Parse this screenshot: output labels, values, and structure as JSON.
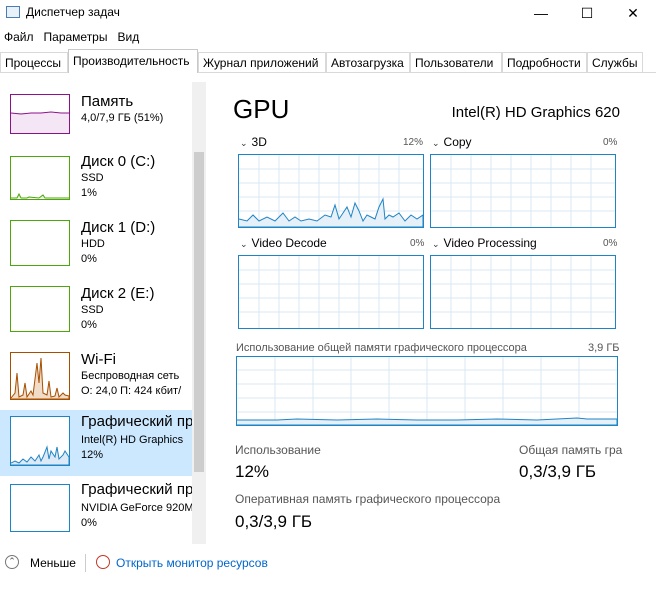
{
  "window": {
    "title": "Диспетчер задач",
    "minimize_glyph": "—",
    "maximize_glyph": "☐",
    "close_glyph": "✕"
  },
  "menu": [
    "Файл",
    "Параметры",
    "Вид"
  ],
  "tabs": [
    {
      "label": "Процессы",
      "active": false
    },
    {
      "label": "Производительность",
      "active": true
    },
    {
      "label": "Журнал приложений",
      "active": false
    },
    {
      "label": "Автозагрузка",
      "active": false
    },
    {
      "label": "Пользователи",
      "active": false
    },
    {
      "label": "Подробности",
      "active": false
    },
    {
      "label": "Службы",
      "active": false
    }
  ],
  "sidebar": {
    "items": [
      {
        "name": "Память",
        "line1": "4,0/7,9 ГБ (51%)",
        "line2": "",
        "color": "#8b128b",
        "selected": false
      },
      {
        "name": "Диск 0 (C:)",
        "line1": "SSD",
        "line2": "1%",
        "color": "#4da60c",
        "selected": false
      },
      {
        "name": "Диск 1 (D:)",
        "line1": "HDD",
        "line2": "0%",
        "color": "#4da60c",
        "selected": false
      },
      {
        "name": "Диск 2 (E:)",
        "line1": "SSD",
        "line2": "0%",
        "color": "#4da60c",
        "selected": false
      },
      {
        "name": "Wi-Fi",
        "line1": "Беспроводная сеть",
        "line2": "О: 24,0 П: 424 кбит/",
        "color": "#a74f01",
        "selected": false
      },
      {
        "name": "Графический пр",
        "line1": "Intel(R) HD Graphics",
        "line2": "12%",
        "color": "#1f84c5",
        "selected": true
      },
      {
        "name": "Графический пр",
        "line1": "NVIDIA GeForce 920M",
        "line2": "0%",
        "color": "#1f84c5",
        "selected": false
      }
    ]
  },
  "gpu": {
    "title": "GPU",
    "model": "Intel(R) HD Graphics 620",
    "engines": [
      {
        "label": "3D",
        "percent": "12%"
      },
      {
        "label": "Copy",
        "percent": "0%"
      },
      {
        "label": "Video Decode",
        "percent": "0%"
      },
      {
        "label": "Video Processing",
        "percent": "0%"
      }
    ],
    "shared_memory_label": "Использование общей памяти графического процессора",
    "shared_memory_max": "3,9 ГБ",
    "usage_label": "Использование",
    "usage_value": "12%",
    "shared_total_label": "Общая память гра",
    "shared_total_value": "0,3/3,9 ГБ",
    "gpu_memory_label": "Оперативная память графического процессора",
    "gpu_memory_value": "0,3/3,9 ГБ"
  },
  "footer": {
    "less_label": "Меньше",
    "monitor_link": "Открыть монитор ресурсов"
  },
  "colors": {
    "gpu_accent": "#1f84c5",
    "selection": "#cce8ff",
    "link": "#0066cc"
  }
}
